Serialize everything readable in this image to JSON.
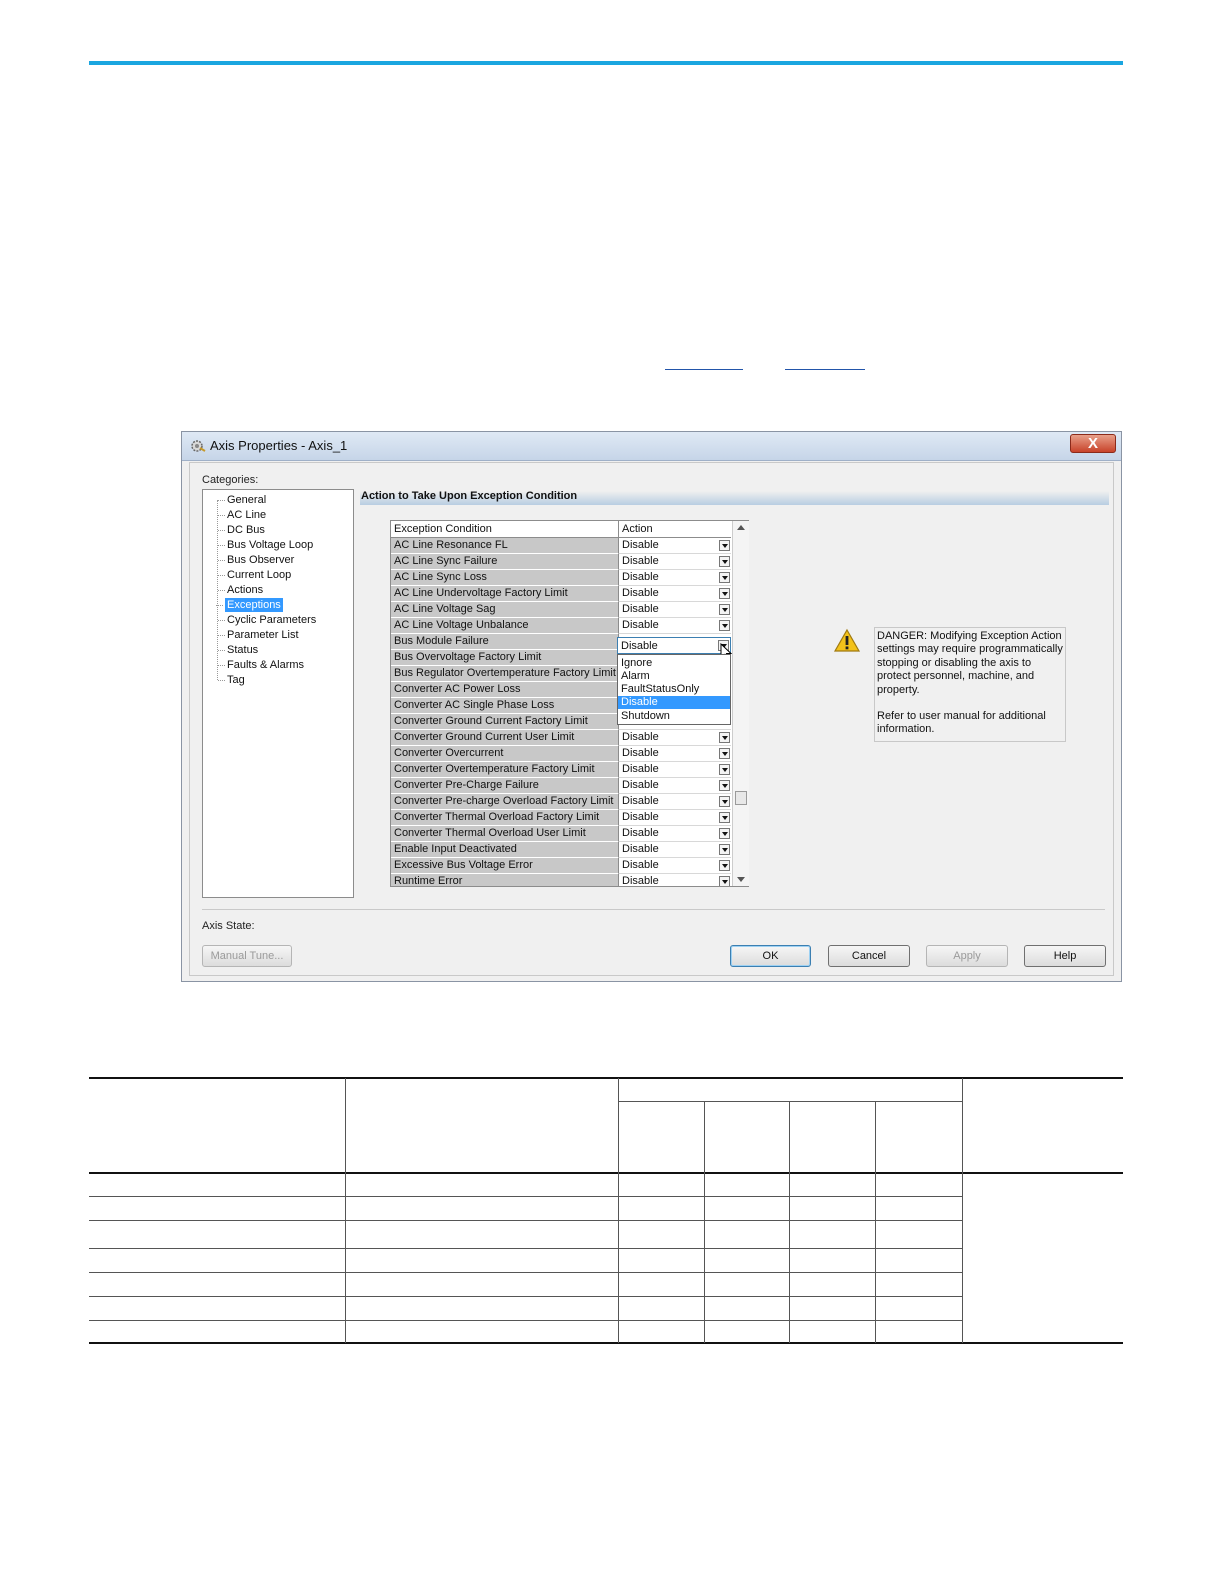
{
  "dialog": {
    "title": "Axis Properties - Axis_1",
    "close_label": "X",
    "categories_label": "Categories:",
    "categories": [
      "General",
      "AC Line",
      "DC Bus",
      "Bus Voltage Loop",
      "Bus Observer",
      "Current Loop",
      "Actions",
      "Exceptions",
      "Cyclic Parameters",
      "Parameter List",
      "Status",
      "Faults & Alarms",
      "Tag"
    ],
    "selected_category": "Exceptions",
    "section_title": "Action to Take Upon Exception Condition",
    "grid": {
      "headers": [
        "Exception Condition",
        "Action"
      ],
      "rows": [
        {
          "condition": "AC Line Resonance FL",
          "action": "Disable"
        },
        {
          "condition": "AC Line Sync Failure",
          "action": "Disable"
        },
        {
          "condition": "AC Line Sync Loss",
          "action": "Disable"
        },
        {
          "condition": "AC Line Undervoltage Factory Limit",
          "action": "Disable"
        },
        {
          "condition": "AC Line Voltage Sag",
          "action": "Disable"
        },
        {
          "condition": "AC Line Voltage Unbalance",
          "action": "Disable"
        },
        {
          "condition": "Bus Module Failure",
          "action": "Disable"
        },
        {
          "condition": "Bus Overvoltage Factory Limit",
          "action": ""
        },
        {
          "condition": "Bus Regulator Overtemperature Factory Limit",
          "action": ""
        },
        {
          "condition": "Converter AC Power Loss",
          "action": ""
        },
        {
          "condition": "Converter AC Single Phase Loss",
          "action": ""
        },
        {
          "condition": "Converter Ground Current Factory Limit",
          "action": ""
        },
        {
          "condition": "Converter Ground Current User Limit",
          "action": "Disable"
        },
        {
          "condition": "Converter Overcurrent",
          "action": "Disable"
        },
        {
          "condition": "Converter Overtemperature Factory Limit",
          "action": "Disable"
        },
        {
          "condition": "Converter Pre-Charge Failure",
          "action": "Disable"
        },
        {
          "condition": "Converter Pre-charge Overload Factory Limit",
          "action": "Disable"
        },
        {
          "condition": "Converter Thermal Overload Factory Limit",
          "action": "Disable"
        },
        {
          "condition": "Converter Thermal Overload User Limit",
          "action": "Disable"
        },
        {
          "condition": "Enable Input Deactivated",
          "action": "Disable"
        },
        {
          "condition": "Excessive Bus Voltage Error",
          "action": "Disable"
        },
        {
          "condition": "Runtime Error",
          "action": "Disable"
        }
      ]
    },
    "open_combo": {
      "value": "Disable",
      "options": [
        "Ignore",
        "Alarm",
        "FaultStatusOnly",
        "Disable",
        "Shutdown"
      ],
      "selected": "Disable"
    },
    "danger_text": "DANGER: Modifying Exception Action settings may require programmatically stopping or disabling the axis to protect personnel, machine, and property.",
    "refer_text": "Refer to user manual for additional information.",
    "axis_state_label": "Axis State:",
    "buttons": {
      "manual_tune": "Manual Tune...",
      "ok": "OK",
      "cancel": "Cancel",
      "apply": "Apply",
      "help": "Help"
    }
  },
  "colors": {
    "accent_rule": "#1aa6e0",
    "selection": "#3399ff"
  }
}
